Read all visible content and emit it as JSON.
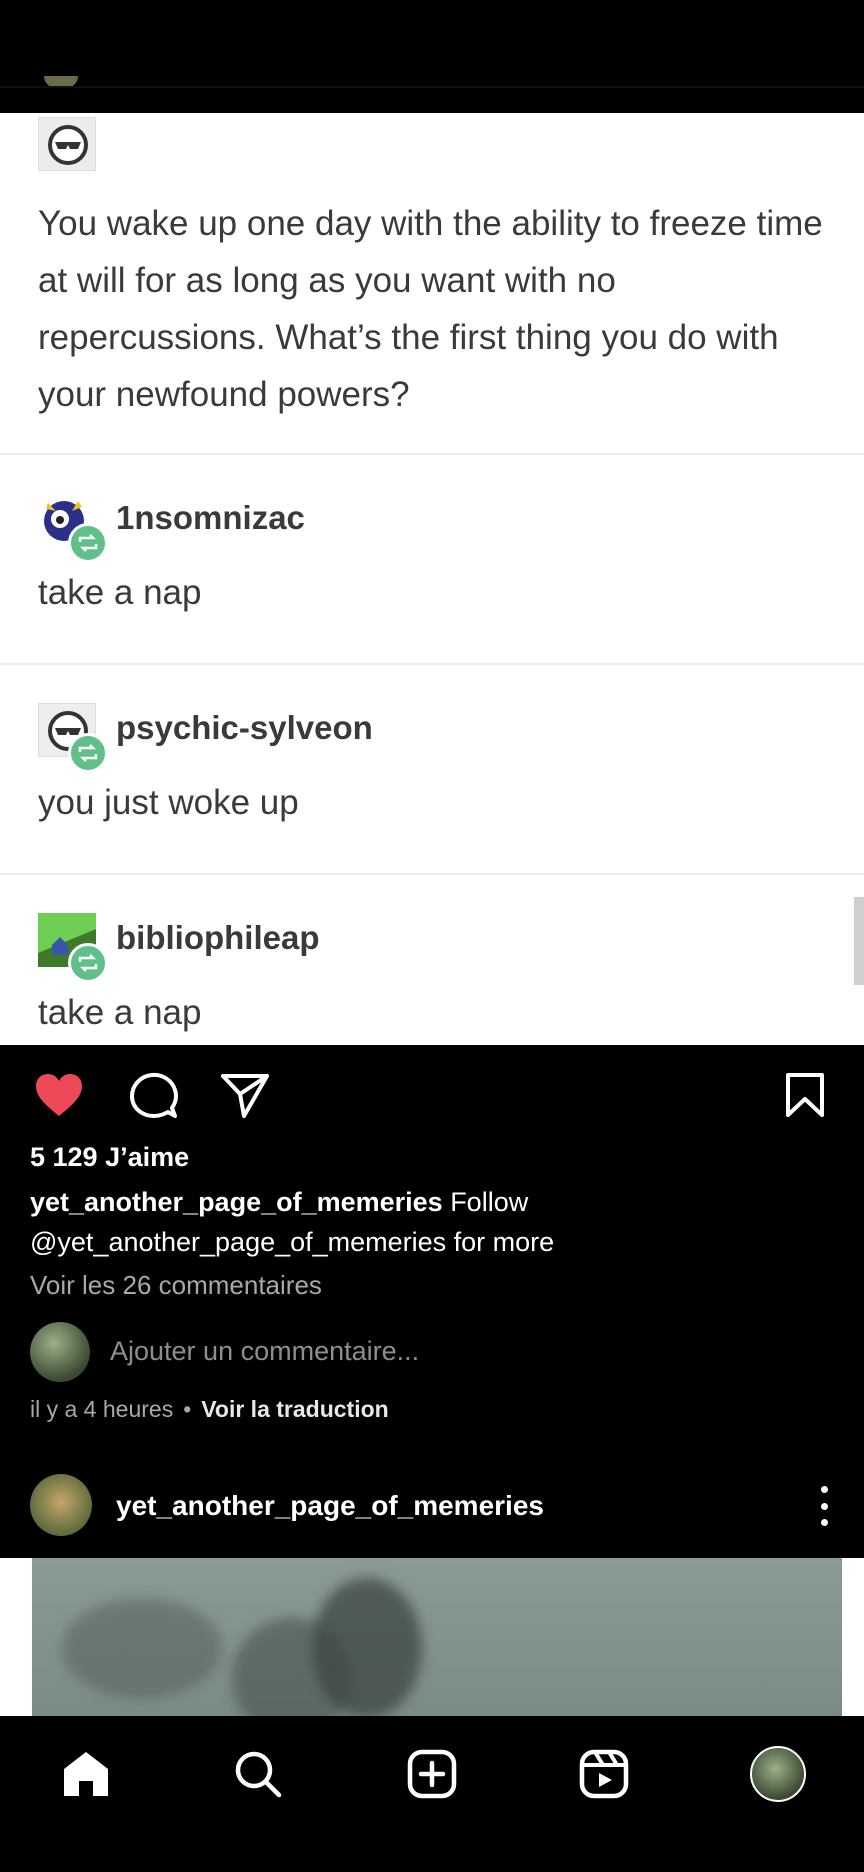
{
  "post": {
    "tumblr": {
      "question": "You wake up one day with the ability to freeze time at will for as long as you want with no repercussions. What’s the first thing you do with your newfound powers?",
      "replies": [
        {
          "username": "1nsomnizac",
          "text": "take a nap"
        },
        {
          "username": "psychic-sylveon",
          "text": "you just woke up"
        },
        {
          "username": "bibliophileap",
          "text": "take a nap"
        }
      ]
    },
    "likes": "5 129 J’aime",
    "caption_user": "yet_another_page_of_memeries",
    "caption_text": " Follow @yet_another_page_of_memeries for more",
    "view_comments": "Voir les 26 commentaires",
    "comment_placeholder": "Ajouter un commentaire...",
    "time_ago": "il y a 4 heures",
    "separator": "•",
    "translate": "Voir la traduction"
  },
  "next_post": {
    "username": "yet_another_page_of_memeries"
  },
  "icons": {
    "like": "heart-filled-icon",
    "comment": "comment-icon",
    "share": "send-icon",
    "save": "bookmark-icon",
    "nav": [
      "home-icon",
      "search-icon",
      "create-icon",
      "reels-icon",
      "profile-avatar"
    ]
  },
  "colors": {
    "like": "#ed4956",
    "reblog": "#5fc08a"
  }
}
